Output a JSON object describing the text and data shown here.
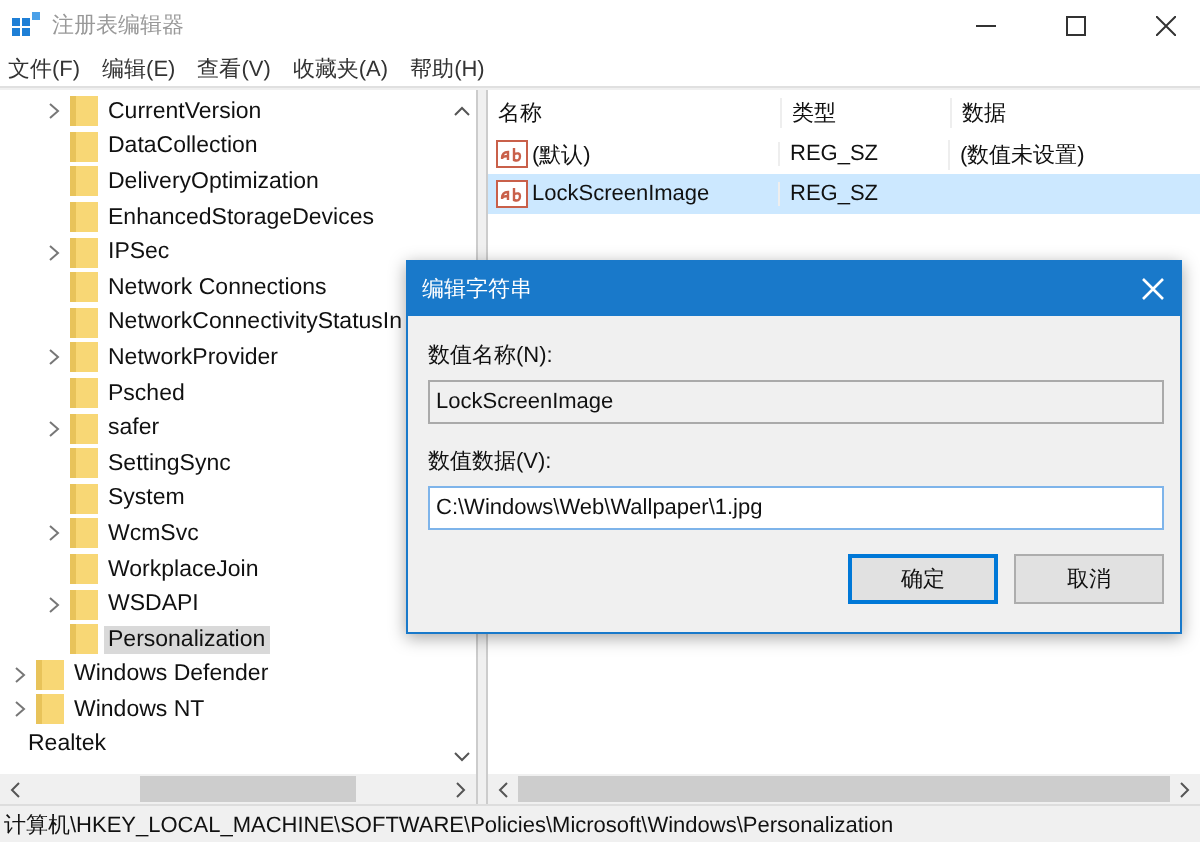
{
  "window": {
    "title": "注册表编辑器"
  },
  "menu": [
    "文件(F)",
    "编辑(E)",
    "查看(V)",
    "收藏夹(A)",
    "帮助(H)"
  ],
  "tree": {
    "nodes": [
      {
        "children": [
          {
            "children": [
              {
                "label": "CurrentVersion",
                "has_children": true,
                "selected": false
              },
              {
                "label": "DataCollection",
                "has_children": false,
                "selected": false
              },
              {
                "label": "DeliveryOptimization",
                "has_children": false,
                "selected": false
              },
              {
                "label": "EnhancedStorageDevices",
                "has_children": false,
                "selected": false
              },
              {
                "label": "IPSec",
                "has_children": true,
                "selected": false
              },
              {
                "label": "Network Connections",
                "has_children": false,
                "selected": false
              },
              {
                "label": "NetworkConnectivityStatusIn",
                "has_children": false,
                "selected": false
              },
              {
                "label": "NetworkProvider",
                "has_children": true,
                "selected": false
              },
              {
                "label": "Psched",
                "has_children": false,
                "selected": false
              },
              {
                "label": "safer",
                "has_children": true,
                "selected": false
              },
              {
                "label": "SettingSync",
                "has_children": false,
                "selected": false
              },
              {
                "label": "System",
                "has_children": false,
                "selected": false
              },
              {
                "label": "WcmSvc",
                "has_children": true,
                "selected": false
              },
              {
                "label": "WorkplaceJoin",
                "has_children": false,
                "selected": false
              },
              {
                "label": "WSDAPI",
                "has_children": true,
                "selected": false
              },
              {
                "label": "Personalization",
                "has_children": false,
                "selected": true
              }
            ]
          },
          {
            "label": "Windows Defender",
            "has_children": true,
            "selected": false
          },
          {
            "label": "Windows NT",
            "has_children": true,
            "selected": false
          }
        ]
      },
      {
        "label": "Realtek",
        "has_children": false,
        "selected": false,
        "folder": false
      }
    ]
  },
  "values": {
    "columns": [
      "名称",
      "类型",
      "数据"
    ],
    "rows": [
      {
        "name": "(默认)",
        "type": "REG_SZ",
        "data": "(数值未设置)",
        "selected": false
      },
      {
        "name": "LockScreenImage",
        "type": "REG_SZ",
        "selected": true
      }
    ]
  },
  "dialog": {
    "title": "编辑字符串",
    "name_label": "数值名称(N):",
    "name_value": "LockScreenImage",
    "data_label": "数值数据(V):",
    "data_value": "C:\\Windows\\Web\\Wallpaper\\1.jpg",
    "buttons": [
      {
        "label": "确定",
        "default": true
      },
      {
        "label": "取消",
        "default": false
      }
    ]
  },
  "status_bar": "计算机\\HKEY_LOCAL_MACHINE\\SOFTWARE\\Policies\\Microsoft\\Windows\\Personalization"
}
